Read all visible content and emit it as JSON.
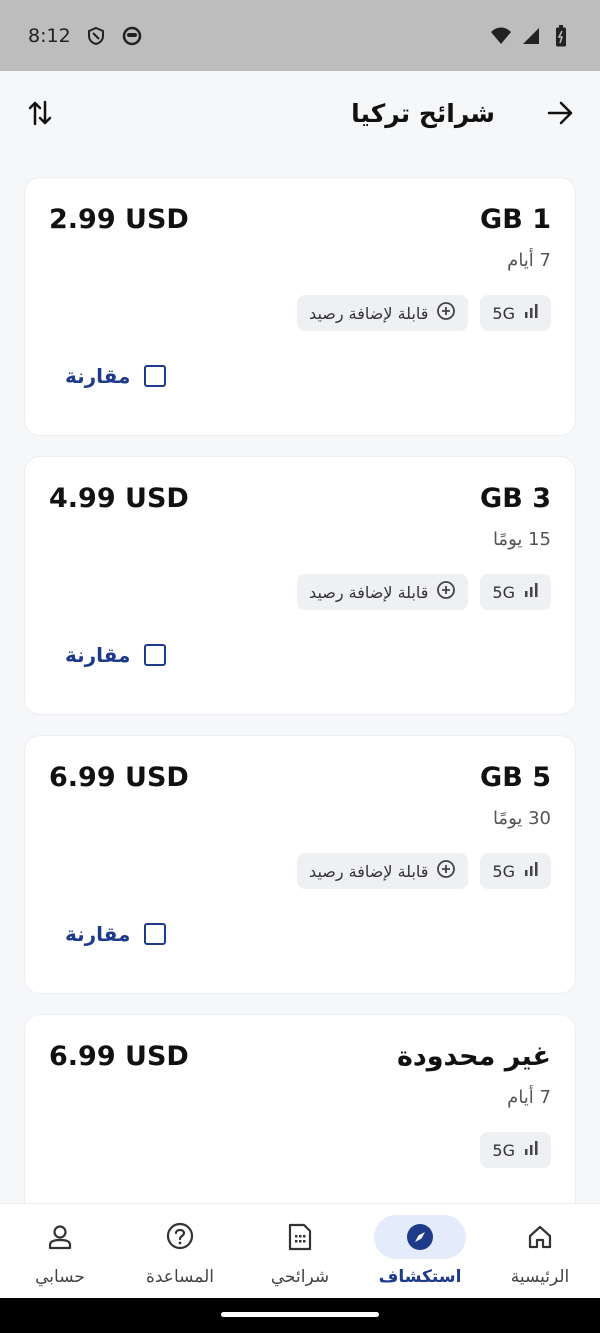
{
  "status_bar": {
    "time": "8:12"
  },
  "header": {
    "title": "شرائح تركيا"
  },
  "plans": [
    {
      "data": "1 GB",
      "validity": "7 أيام",
      "price": "2.99 USD",
      "network": "5G",
      "topup": "قابلة لإضافة رصيد",
      "compare": "مقارنة"
    },
    {
      "data": "3 GB",
      "validity": "15 يومًا",
      "price": "4.99 USD",
      "network": "5G",
      "topup": "قابلة لإضافة رصيد",
      "compare": "مقارنة"
    },
    {
      "data": "5 GB",
      "validity": "30 يومًا",
      "price": "6.99 USD",
      "network": "5G",
      "topup": "قابلة لإضافة رصيد",
      "compare": "مقارنة"
    },
    {
      "data": "غير محدودة",
      "validity": "7 أيام",
      "price": "6.99 USD",
      "network": "5G"
    }
  ],
  "bottom_nav": {
    "items": [
      {
        "label": "الرئيسية",
        "icon": "home-icon"
      },
      {
        "label": "استكشاف",
        "icon": "compass-icon",
        "active": true
      },
      {
        "label": "شرائحي",
        "icon": "sim-icon"
      },
      {
        "label": "المساعدة",
        "icon": "help-icon"
      },
      {
        "label": "حسابي",
        "icon": "user-icon"
      }
    ]
  },
  "colors": {
    "accent": "#1e3a8a",
    "active_nav_bg": "#e4ecfb",
    "status_bar_bg": "#bdbdbd"
  }
}
